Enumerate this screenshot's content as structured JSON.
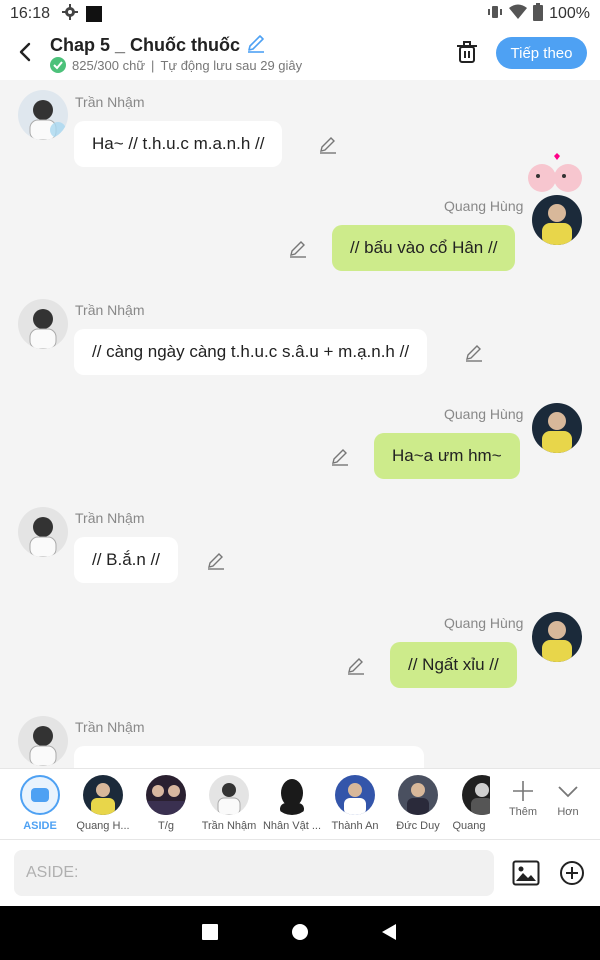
{
  "status_bar": {
    "time": "16:18",
    "battery": "100%"
  },
  "header": {
    "title": "Chap 5 _ Chuốc thuốc",
    "word_count": "825/300 chữ",
    "separator": "|",
    "autosave": "Tự động lưu sau 29 giây",
    "next_button": "Tiếp theo"
  },
  "messages": [
    {
      "side": "left",
      "name": "Trần Nhậm",
      "text": "Ha~ // t.h.u.c m.a.n.h //"
    },
    {
      "side": "right",
      "name": "Quang Hùng",
      "text": "// bấu vào cổ Hân //"
    },
    {
      "side": "left",
      "name": "Trần Nhậm",
      "text": "// càng ngày càng t.h.u.c s.â.u + m.ạ.n.h //"
    },
    {
      "side": "right",
      "name": "Quang Hùng",
      "text": "Ha~a ưm hm~"
    },
    {
      "side": "left",
      "name": "Trần Nhậm",
      "text": "// B.ắ.n //"
    },
    {
      "side": "right",
      "name": "Quang Hùng",
      "text": "// Ngất xỉu //"
    },
    {
      "side": "left",
      "name": "Trần Nhậm",
      "text": ""
    }
  ],
  "characters": [
    {
      "label": "ASIDE",
      "selected": true,
      "color": "#4ea1f3"
    },
    {
      "label": "Quang H...",
      "color": "#1b2a3a"
    },
    {
      "label": "T/g",
      "color": "#2a2030"
    },
    {
      "label": "Trần Nhậm",
      "color": "#d8d8d8"
    },
    {
      "label": "Nhân Vật ...",
      "color": "#1a1a1a"
    },
    {
      "label": "Thành An",
      "color": "#3355aa"
    },
    {
      "label": "Đức Duy",
      "color": "#4a5060"
    },
    {
      "label": "Quang",
      "color": "#202020"
    }
  ],
  "tools": {
    "add": "Thêm",
    "more": "Hơn"
  },
  "input": {
    "placeholder": "ASIDE:"
  },
  "colors": {
    "accent": "#4ea1f3",
    "right_bubble": "#cdeb8b",
    "left_bubble": "#ffffff",
    "save_check": "#4cc17a"
  }
}
